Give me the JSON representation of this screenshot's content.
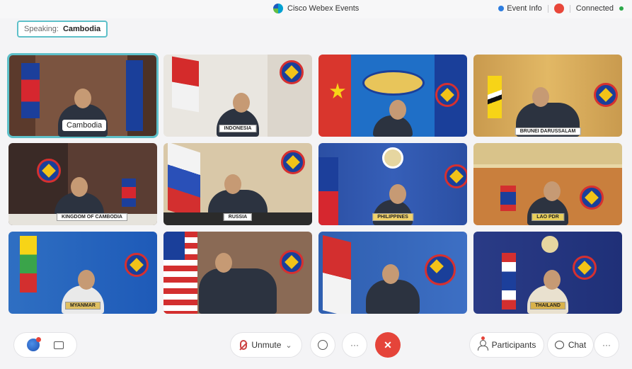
{
  "window": {
    "title": "Cisco Webex Events"
  },
  "header": {
    "event_info_label": "Event Info",
    "connection_status": "Connected"
  },
  "speaking": {
    "label": "Speaking:",
    "name": "Cambodia"
  },
  "tiles": [
    {
      "name_label": "Cambodia",
      "nameplate": ""
    },
    {
      "nameplate": "INDONESIA"
    },
    {
      "nameplate": ""
    },
    {
      "nameplate": "BRUNEI DARUSSALAM"
    },
    {
      "nameplate": "KINGDOM OF CAMBODIA"
    },
    {
      "nameplate": "RUSSIA"
    },
    {
      "nameplate": "PHILIPPINES"
    },
    {
      "nameplate": "LAO PDR"
    },
    {
      "nameplate": "MYANMAR"
    },
    {
      "nameplate": ""
    },
    {
      "nameplate": ""
    },
    {
      "nameplate": "THAILAND"
    }
  ],
  "controls": {
    "unmute_label": "Unmute",
    "more_label": "···",
    "end_label": "✕",
    "participants_label": "Participants",
    "chat_label": "Chat",
    "overflow_label": "···",
    "dropdown_chevron": "⌄"
  },
  "colors": {
    "accent": "#5ec0c9",
    "end_call": "#e5443a",
    "connected": "#2ca84a"
  }
}
